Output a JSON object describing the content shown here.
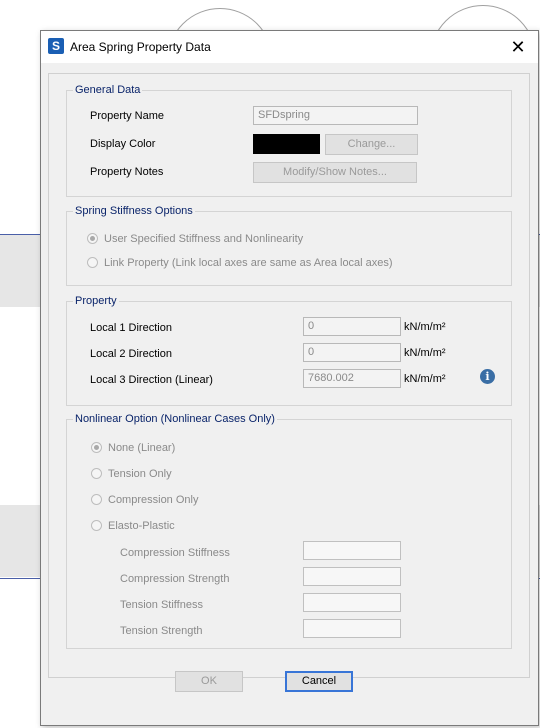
{
  "dialog": {
    "title": "Area Spring Property Data",
    "app_icon_letter": "S",
    "close_glyph": "✕"
  },
  "general_data": {
    "title": "General Data",
    "property_name_label": "Property Name",
    "property_name_value": "SFDspring",
    "display_color_label": "Display Color",
    "display_color": "#000000",
    "change_button": "Change...",
    "property_notes_label": "Property Notes",
    "notes_button": "Modify/Show Notes..."
  },
  "spring_stiffness": {
    "title": "Spring Stiffness Options",
    "options": [
      {
        "label": "User Specified Stiffness and Nonlinearity",
        "checked": true
      },
      {
        "label": "Link Property (Link local axes are same as Area local axes)",
        "checked": false
      }
    ]
  },
  "property": {
    "title": "Property",
    "rows": [
      {
        "label": "Local 1 Direction",
        "value": "0",
        "unit": "kN/m/m²"
      },
      {
        "label": "Local 2 Direction",
        "value": "0",
        "unit": "kN/m/m²"
      },
      {
        "label": "Local 3 Direction (Linear)",
        "value": "7680.002",
        "unit": "kN/m/m²"
      }
    ],
    "info_icon": "info-icon"
  },
  "nonlinear": {
    "title": "Nonlinear Option (Nonlinear Cases Only)",
    "options": [
      {
        "label": "None (Linear)",
        "checked": true
      },
      {
        "label": "Tension Only",
        "checked": false
      },
      {
        "label": "Compression Only",
        "checked": false
      },
      {
        "label": "Elasto-Plastic",
        "checked": false
      }
    ],
    "fields": [
      {
        "label": "Compression Stiffness",
        "value": ""
      },
      {
        "label": "Compression Strength",
        "value": ""
      },
      {
        "label": "Tension Stiffness",
        "value": ""
      },
      {
        "label": "Tension Strength",
        "value": ""
      }
    ]
  },
  "buttons": {
    "ok": "OK",
    "cancel": "Cancel"
  },
  "colors": {
    "group_title": "#0a246a",
    "dialog_bg": "#f0f0f0",
    "app_icon": "#1a5fb4"
  }
}
